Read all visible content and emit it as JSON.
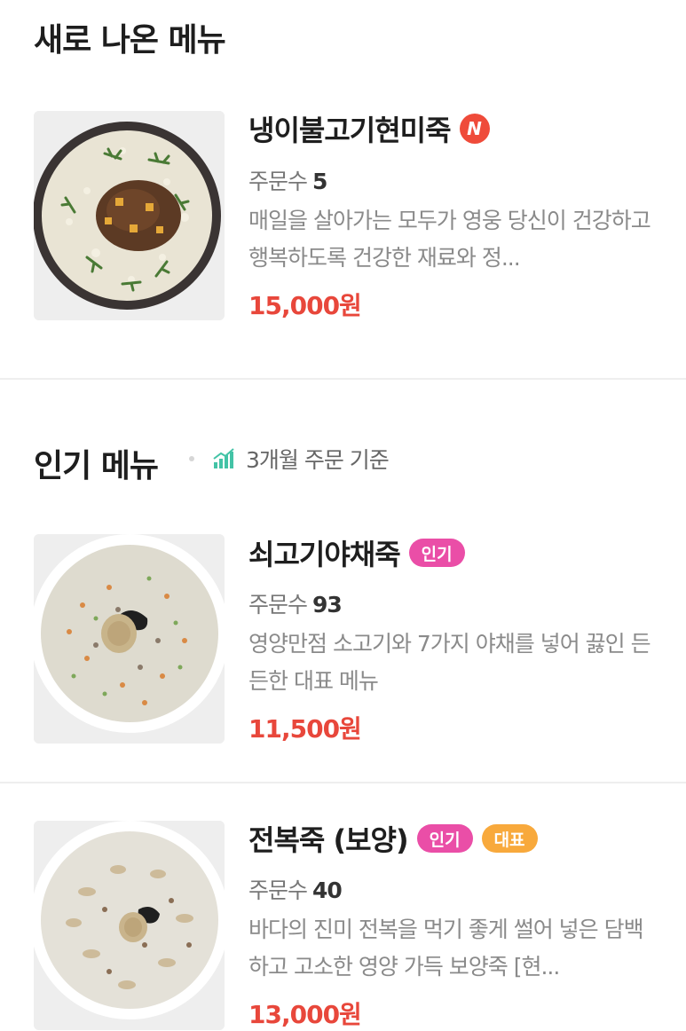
{
  "new_section": {
    "title": "새로 나온 메뉴",
    "item": {
      "name": "냉이불고기현미죽",
      "badge": "N",
      "orders_label": "주문수",
      "orders": "5",
      "desc": "매일을 살아가는 모두가 영웅 당신이 건강하고 행복하도록 건강한 재료와 정...",
      "price": "15,000원",
      "image": "beef-bulgogi-porridge-image"
    }
  },
  "popular_section": {
    "title": "인기 메뉴",
    "basis_icon": "bar-chart-icon",
    "basis": "3개월 주문 기준",
    "items": [
      {
        "name": "쇠고기야채죽",
        "badges": [
          "인기"
        ],
        "orders_label": "주문수",
        "orders": "93",
        "desc": "영양만점 소고기와 7가지 야채를 넣어 끓인 든든한 대표 메뉴",
        "price": "11,500원",
        "image": "beef-vegetable-porridge-image"
      },
      {
        "name": "전복죽 (보양)",
        "badges": [
          "인기",
          "대표"
        ],
        "orders_label": "주문수",
        "orders": "40",
        "desc": "바다의 진미 전복을 먹기 좋게 썰어 넣은 담백하고 고소한 영양 가득 보양죽 [현...",
        "price": "13,000원",
        "image": "abalone-porridge-image"
      }
    ]
  },
  "colors": {
    "price": "#e8473b",
    "badge_popular": "#ea4ea7",
    "badge_representative": "#f8a93c",
    "badge_new": "#ef4b3a"
  }
}
